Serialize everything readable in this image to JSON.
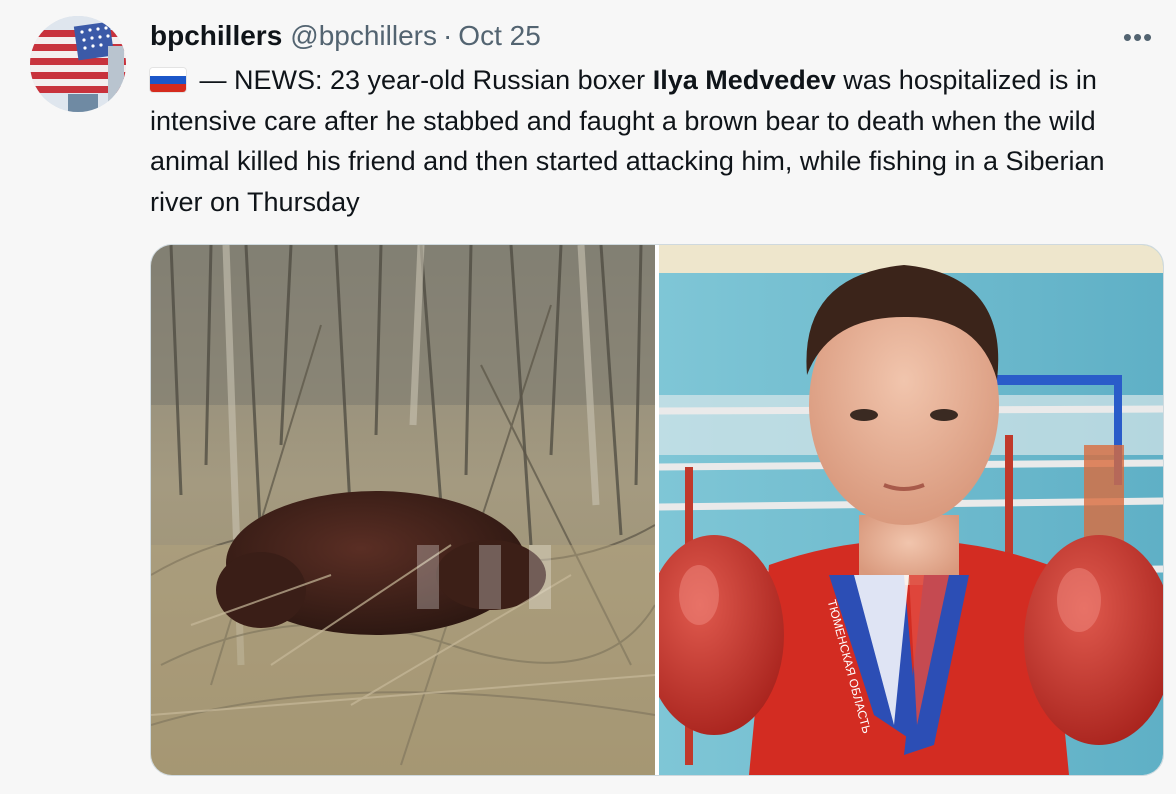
{
  "tweet": {
    "display_name": "bpchillers",
    "handle": "@bpchillers",
    "separator": "·",
    "date": "Oct 25",
    "more_icon": "more-horizontal-icon",
    "more_glyph": "•••",
    "flag_icon": "russia-flag-icon",
    "text_part1": " — NEWS: 23 year-old Russian boxer ",
    "text_bold": "Ilya Medvedev",
    "text_part2": " was hospitalized is in intensive care after he stabbed and faught a brown bear to death when the wild animal killed his friend and then started attacking him, while fishing in a Siberian river on Thursday"
  },
  "media": {
    "left_photo": "bear-in-forest-photo",
    "right_photo": "boxer-portrait-photo",
    "medal_ribbon_text": "ТЮМЕНСКАЯ ОБЛАСТЬ"
  },
  "colors": {
    "text_primary": "#0f1419",
    "text_secondary": "#536471",
    "background": "#f7f7f7",
    "border": "#cfd9de"
  }
}
